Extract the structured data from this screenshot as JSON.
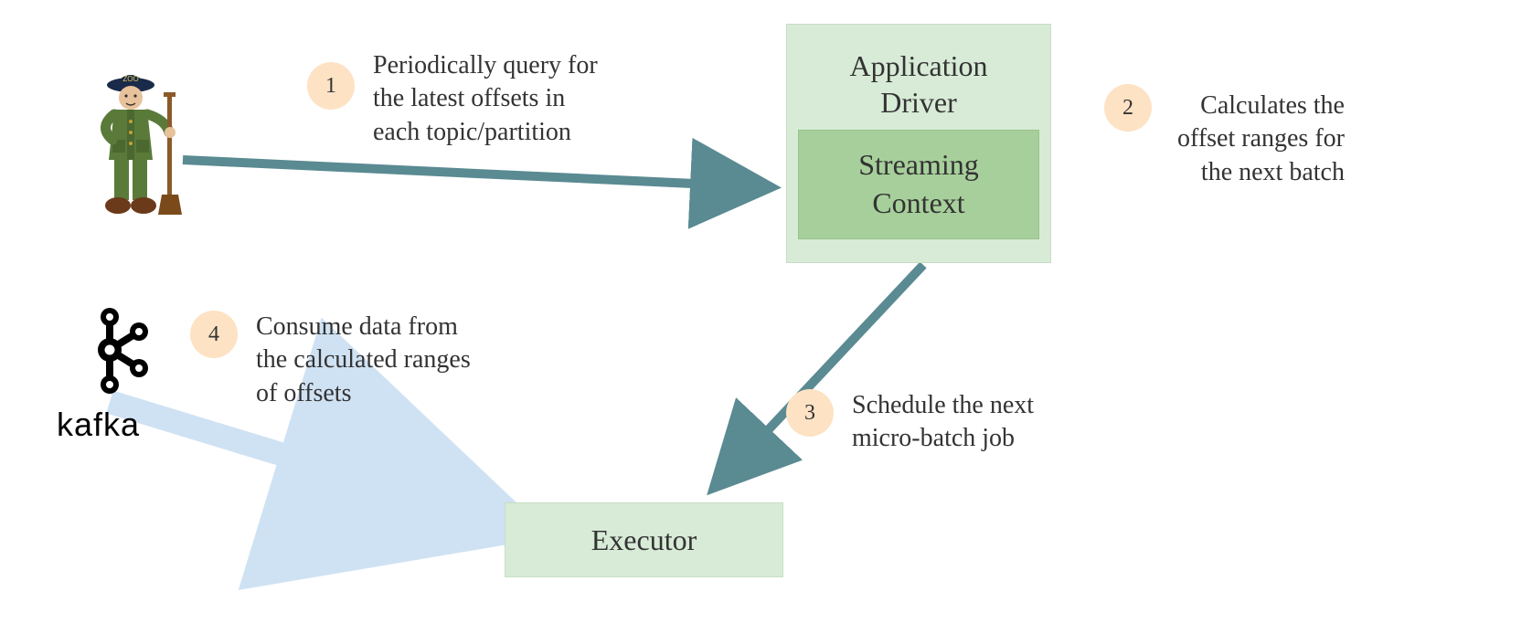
{
  "driver": {
    "title": "Application\nDriver",
    "inner": "Streaming\nContext"
  },
  "executor": {
    "label": "Executor"
  },
  "kafka": {
    "label": "kafka"
  },
  "steps": [
    {
      "num": "1",
      "text": "Periodically query for\nthe latest offsets in\neach topic/partition"
    },
    {
      "num": "2",
      "text": "Calculates the\noffset ranges for\nthe next batch"
    },
    {
      "num": "3",
      "text": "Schedule the next\nmicro-batch job"
    },
    {
      "num": "4",
      "text": "Consume data from\nthe calculated ranges\nof offsets"
    }
  ]
}
